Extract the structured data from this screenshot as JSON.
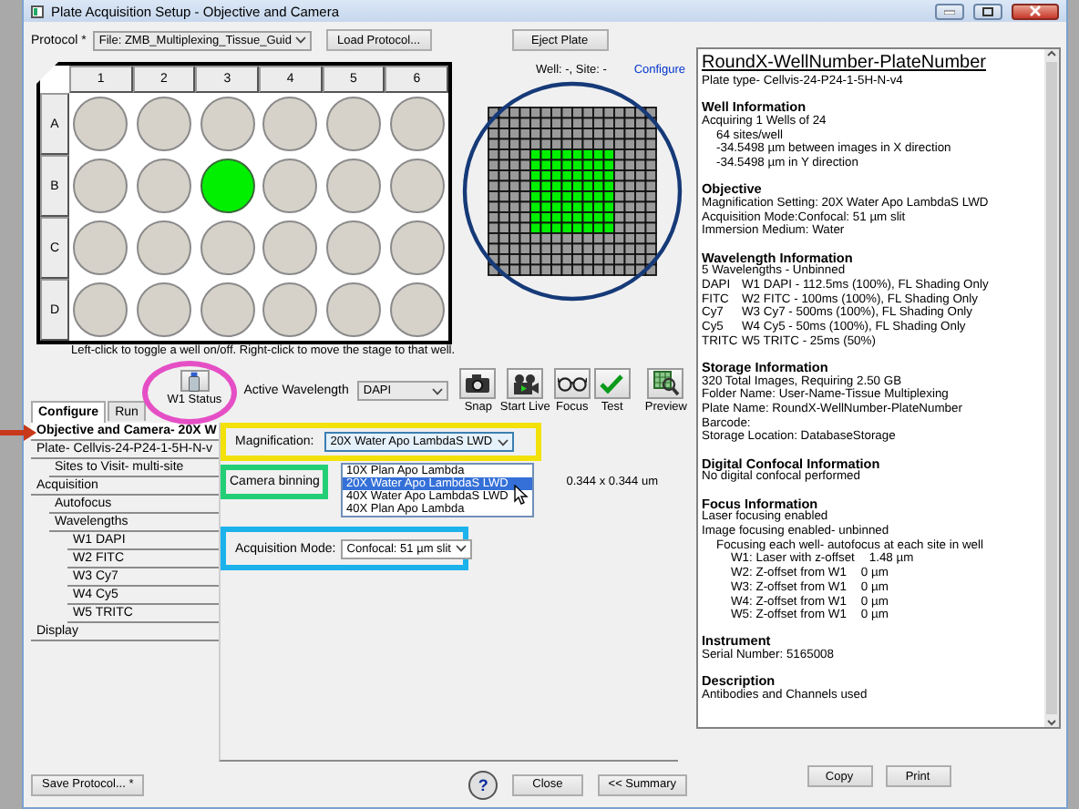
{
  "window": {
    "title": "Plate Acquisition Setup - Objective and Camera"
  },
  "protocol": {
    "label": "Protocol *",
    "value": "File: ZMB_Multiplexing_Tissue_Guid",
    "load_button": "Load Protocol...",
    "eject_button": "Eject Plate"
  },
  "plate": {
    "columns": [
      "1",
      "2",
      "3",
      "4",
      "5",
      "6"
    ],
    "rows": [
      {
        "label": "A",
        "wells": [
          {
            "selected": false
          },
          {
            "selected": false
          },
          {
            "selected": false
          },
          {
            "selected": false
          },
          {
            "selected": false
          },
          {
            "selected": false
          }
        ]
      },
      {
        "label": "B",
        "wells": [
          {
            "selected": false
          },
          {
            "selected": false
          },
          {
            "selected": true
          },
          {
            "selected": false
          },
          {
            "selected": false
          },
          {
            "selected": false
          }
        ]
      },
      {
        "label": "C",
        "wells": [
          {
            "selected": false
          },
          {
            "selected": false
          },
          {
            "selected": false
          },
          {
            "selected": false
          },
          {
            "selected": false
          },
          {
            "selected": false
          }
        ]
      },
      {
        "label": "D",
        "wells": [
          {
            "selected": false
          },
          {
            "selected": false
          },
          {
            "selected": false
          },
          {
            "selected": false
          },
          {
            "selected": false
          },
          {
            "selected": false
          }
        ]
      }
    ]
  },
  "site_map": {
    "position": "Well: -,  Site: -",
    "configure_link": "Configure",
    "rows": [
      [
        false,
        false,
        false,
        false,
        false,
        false,
        false,
        false,
        false,
        false,
        false,
        false,
        false,
        false,
        false,
        false
      ],
      [
        false,
        false,
        false,
        false,
        false,
        false,
        false,
        false,
        false,
        false,
        false,
        false,
        false,
        false,
        false,
        false
      ],
      [
        false,
        false,
        false,
        false,
        false,
        false,
        false,
        false,
        false,
        false,
        false,
        false,
        false,
        false,
        false,
        false
      ],
      [
        false,
        false,
        false,
        false,
        false,
        false,
        false,
        false,
        false,
        false,
        false,
        false,
        false,
        false,
        false,
        false
      ],
      [
        false,
        false,
        false,
        false,
        true,
        true,
        true,
        true,
        true,
        true,
        true,
        true,
        false,
        false,
        false,
        false
      ],
      [
        false,
        false,
        false,
        false,
        true,
        true,
        true,
        true,
        true,
        true,
        true,
        true,
        false,
        false,
        false,
        false
      ],
      [
        false,
        false,
        false,
        false,
        true,
        true,
        true,
        true,
        true,
        true,
        true,
        true,
        false,
        false,
        false,
        false
      ],
      [
        false,
        false,
        false,
        false,
        true,
        true,
        true,
        true,
        true,
        true,
        true,
        true,
        false,
        false,
        false,
        false
      ],
      [
        false,
        false,
        false,
        false,
        true,
        true,
        true,
        true,
        true,
        true,
        true,
        true,
        false,
        false,
        false,
        false
      ],
      [
        false,
        false,
        false,
        false,
        true,
        true,
        true,
        true,
        true,
        true,
        true,
        true,
        false,
        false,
        false,
        false
      ],
      [
        false,
        false,
        false,
        false,
        true,
        true,
        true,
        true,
        true,
        true,
        true,
        true,
        false,
        false,
        false,
        false
      ],
      [
        false,
        false,
        false,
        false,
        true,
        true,
        true,
        true,
        true,
        true,
        true,
        true,
        false,
        false,
        false,
        false
      ],
      [
        false,
        false,
        false,
        false,
        false,
        false,
        false,
        false,
        false,
        false,
        false,
        false,
        false,
        false,
        false,
        false
      ],
      [
        false,
        false,
        false,
        false,
        false,
        false,
        false,
        false,
        false,
        false,
        false,
        false,
        false,
        false,
        false,
        false
      ],
      [
        false,
        false,
        false,
        false,
        false,
        false,
        false,
        false,
        false,
        false,
        false,
        false,
        false,
        false,
        false,
        false
      ],
      [
        false,
        false,
        false,
        false,
        false,
        false,
        false,
        false,
        false,
        false,
        false,
        false,
        false,
        false,
        false,
        false
      ]
    ]
  },
  "hint": "Left-click to toggle a well on/off. Right-click to move the stage to that well.",
  "toolbar": {
    "status_button": "W1 Status",
    "wavelength_label": "Active Wavelength",
    "wavelength": "DAPI",
    "actions": [
      {
        "kind": "snap",
        "label": "Snap"
      },
      {
        "kind": "live",
        "label": "Start Live"
      },
      {
        "kind": "focus",
        "label": "Focus"
      },
      {
        "kind": "test",
        "label": "Test"
      },
      {
        "kind": "preview",
        "label": "Preview"
      }
    ]
  },
  "tabs": [
    {
      "label": "Configure",
      "selected": true
    },
    {
      "label": "Run",
      "selected": false
    }
  ],
  "nav": [
    {
      "label": "Objective and Camera- 20X W",
      "selected": true
    },
    {
      "label": "Plate- Cellvis-24-P24-1-5H-N-v",
      "selected": false,
      "children": [
        {
          "label": "Sites to Visit- multi-site",
          "selected": false
        }
      ]
    },
    {
      "label": "Acquisition",
      "selected": false,
      "children": [
        {
          "label": "Autofocus",
          "selected": false
        },
        {
          "label": "Wavelengths",
          "selected": false,
          "children": [
            {
              "label": "W1 DAPI",
              "selected": false
            },
            {
              "label": "W2 FITC",
              "selected": false
            },
            {
              "label": "W3 Cy7",
              "selected": false
            },
            {
              "label": "W4 Cy5",
              "selected": false
            },
            {
              "label": "W5 TRITC",
              "selected": false
            }
          ]
        }
      ]
    },
    {
      "label": "Display",
      "selected": false
    }
  ],
  "settings": {
    "magnification": {
      "label": "Magnification:",
      "value": "20X Water Apo LambdaS LWD",
      "expanded": true,
      "options": [
        {
          "label": "10X Plan Apo Lambda",
          "selected": false
        },
        {
          "label": "20X Water Apo LambdaS LWD",
          "selected": true
        },
        {
          "label": "40X Water Apo LambdaS LWD",
          "selected": false
        },
        {
          "label": "40X Plan Apo Lambda",
          "selected": false
        }
      ]
    },
    "binning": {
      "label": "Camera binning",
      "pixel_size": "0.344 x 0.344 um"
    },
    "acquisition_mode": {
      "label": "Acquisition Mode:",
      "value": "Confocal: 51 µm slit"
    }
  },
  "summary": {
    "title": "RoundX-WellNumber-PlateNumber",
    "subtitle": "Plate type- Cellvis-24-P24-1-5H-N-v4",
    "sections": [
      {
        "heading": "Well Information",
        "lines": [
          {
            "text": "Acquiring 1 Wells of 24",
            "children": [
              {
                "text": "64 sites/well"
              },
              {
                "text": "-34.5498 µm between images in X direction"
              },
              {
                "text": "-34.5498 µm in Y direction"
              }
            ]
          }
        ]
      },
      {
        "heading": "Objective",
        "lines": [
          {
            "text": "Magnification Setting: 20X Water Apo LambdaS LWD"
          },
          {
            "text": "Acquisition Mode:Confocal: 51 µm slit"
          },
          {
            "text": "Immersion Medium: Water"
          }
        ]
      },
      {
        "heading": "Wavelength Information",
        "lines": [
          {
            "text": "5 Wavelengths - Unbinned"
          },
          {
            "label": "DAPI",
            "text": "W1 DAPI - 112.5ms (100%), FL Shading Only"
          },
          {
            "label": "FITC",
            "text": "W2 FITC - 100ms (100%), FL Shading Only"
          },
          {
            "label": "Cy7",
            "text": "W3 Cy7 - 500ms (100%), FL Shading Only"
          },
          {
            "label": "Cy5",
            "text": "W4 Cy5 - 50ms (100%), FL Shading Only"
          },
          {
            "label": "TRITC",
            "text": "W5 TRITC - 25ms (50%)"
          }
        ]
      },
      {
        "heading": "Storage Information",
        "lines": [
          {
            "text": "320 Total Images,  Requiring 2.50 GB"
          },
          {
            "text": "Folder Name: User-Name-Tissue Multiplexing"
          },
          {
            "text": "Plate Name: RoundX-WellNumber-PlateNumber"
          },
          {
            "text": "Barcode:"
          },
          {
            "text": "Storage Location: DatabaseStorage"
          }
        ]
      },
      {
        "heading": "Digital Confocal Information",
        "lines": [
          {
            "text": "No digital confocal performed"
          }
        ]
      },
      {
        "heading": "Focus Information",
        "lines": [
          {
            "text": "Laser focusing enabled"
          },
          {
            "text": "Image focusing enabled-  unbinned",
            "children": [
              {
                "text": "Focusing each well- autofocus at each site in well",
                "children": [
                  {
                    "text": "W1: Laser with z-offset",
                    "value": "1.48 µm"
                  },
                  {
                    "text": "W2: Z-offset from W1",
                    "value": "0 µm"
                  },
                  {
                    "text": "W3: Z-offset from W1",
                    "value": "0 µm"
                  },
                  {
                    "text": "W4: Z-offset from W1",
                    "value": "0 µm"
                  },
                  {
                    "text": "W5: Z-offset from W1",
                    "value": "0 µm"
                  }
                ]
              }
            ]
          }
        ]
      },
      {
        "heading": "Instrument",
        "lines": [
          {
            "text": "Serial Number: 5165008"
          }
        ]
      },
      {
        "heading": "Description",
        "lines": [
          {
            "text": "Antibodies and Channels used"
          }
        ]
      }
    ]
  },
  "footer": {
    "save_button": "Save Protocol... *",
    "help_button": "?",
    "close_button": "Close",
    "summary_button": "<< Summary",
    "copy_button": "Copy",
    "print_button": "Print"
  }
}
